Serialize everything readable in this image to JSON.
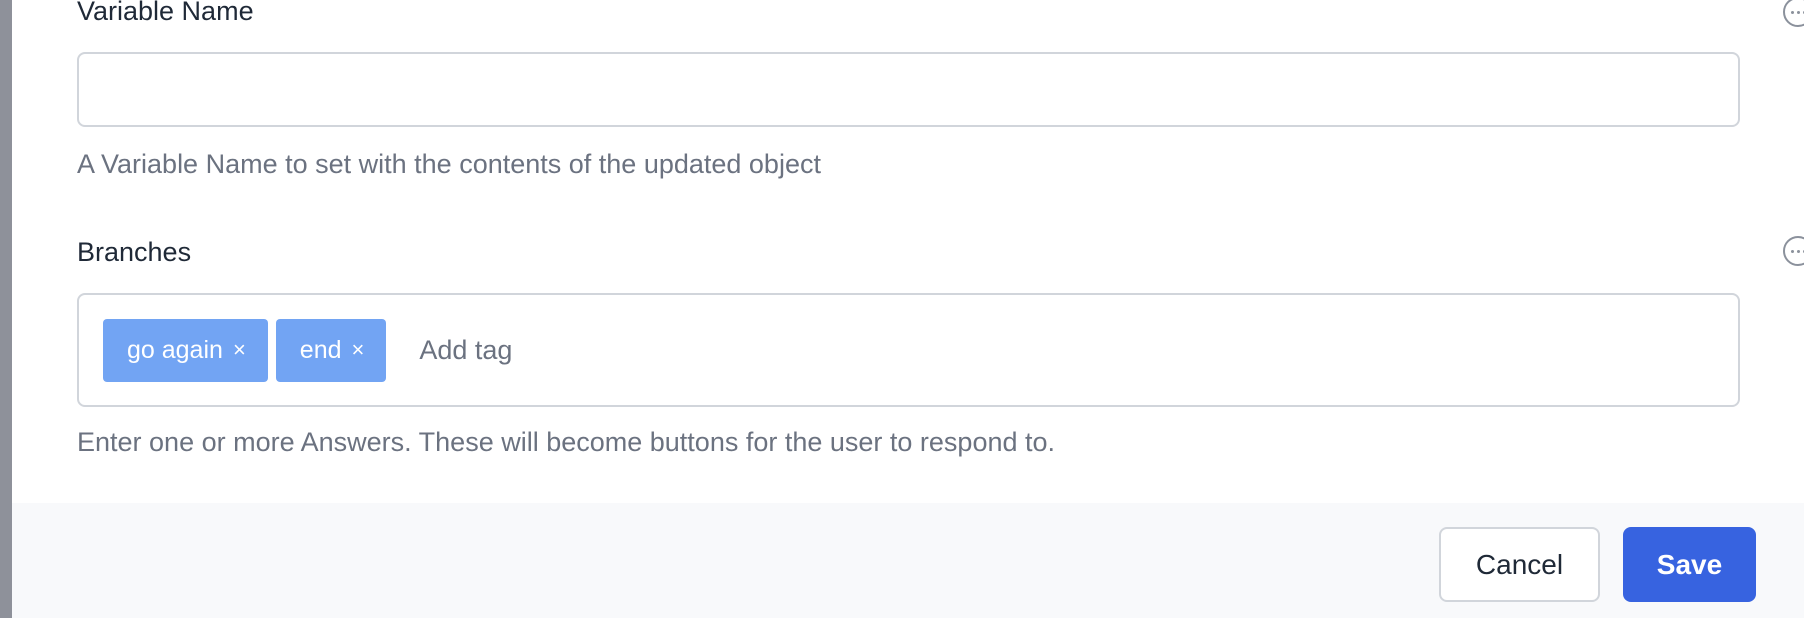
{
  "variable_name": {
    "label": "Variable Name",
    "value": "",
    "placeholder": "",
    "help": "A Variable Name to set with the contents of the updated object"
  },
  "branches": {
    "label": "Branches",
    "tags": [
      {
        "label": "go again",
        "remove": "×"
      },
      {
        "label": "end",
        "remove": "×"
      }
    ],
    "input_placeholder": "Add tag",
    "help": "Enter one or more Answers. These will become buttons for the user to respond to."
  },
  "footer": {
    "cancel_label": "Cancel",
    "save_label": "Save"
  },
  "icons": {
    "more": "more-options-icon"
  },
  "colors": {
    "tag_bg": "#72a4f3",
    "primary": "#3763e0",
    "help_text": "#6b7280",
    "footer_bg": "#f8f9fb"
  }
}
